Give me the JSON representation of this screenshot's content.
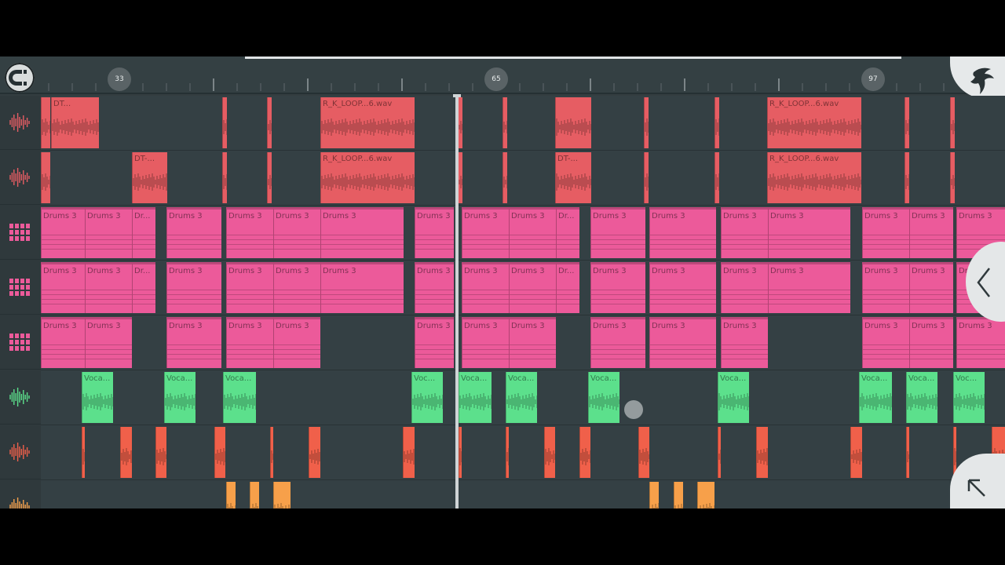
{
  "ruler": {
    "markers": [
      {
        "label": "33"
      },
      {
        "label": "65"
      },
      {
        "label": "97"
      }
    ]
  },
  "tracks": [
    {
      "kind": "audio",
      "color": "#e65d63",
      "icon": "audio-waveform-icon",
      "clips": [
        {
          "s": 0,
          "l": 12,
          "t": ""
        },
        {
          "s": 13,
          "l": 61,
          "t": "DT..."
        },
        {
          "s": 231,
          "l": 6,
          "t": ""
        },
        {
          "s": 288,
          "l": 6,
          "t": ""
        },
        {
          "s": 356,
          "l": 120,
          "t": "R_K_LOOP...6.wav"
        },
        {
          "s": 531,
          "l": 6,
          "t": ""
        },
        {
          "s": 588,
          "l": 6,
          "t": ""
        },
        {
          "s": 655,
          "l": 46,
          "t": ""
        },
        {
          "s": 768,
          "l": 6,
          "t": ""
        },
        {
          "s": 858,
          "l": 6,
          "t": ""
        },
        {
          "s": 925,
          "l": 120,
          "t": "R_K_LOOP...6.wav"
        },
        {
          "s": 1100,
          "l": 6,
          "t": ""
        },
        {
          "s": 1158,
          "l": 6,
          "t": ""
        }
      ]
    },
    {
      "kind": "audio",
      "color": "#e65d63",
      "icon": "audio-waveform-icon",
      "clips": [
        {
          "s": 0,
          "l": 12,
          "t": ""
        },
        {
          "s": 116,
          "l": 45,
          "t": "DT-..."
        },
        {
          "s": 231,
          "l": 6,
          "t": ""
        },
        {
          "s": 288,
          "l": 6,
          "t": ""
        },
        {
          "s": 356,
          "l": 120,
          "t": "R_K_LOOP...6.wav"
        },
        {
          "s": 531,
          "l": 6,
          "t": ""
        },
        {
          "s": 588,
          "l": 6,
          "t": ""
        },
        {
          "s": 655,
          "l": 46,
          "t": "DT-..."
        },
        {
          "s": 768,
          "l": 6,
          "t": ""
        },
        {
          "s": 858,
          "l": 6,
          "t": ""
        },
        {
          "s": 925,
          "l": 120,
          "t": "R_K_LOOP...6.wav"
        },
        {
          "s": 1100,
          "l": 6,
          "t": ""
        },
        {
          "s": 1158,
          "l": 6,
          "t": ""
        }
      ]
    },
    {
      "kind": "pattern",
      "color": "#ec5a9a",
      "icon": "pattern-icon",
      "clips": [
        {
          "s": 0,
          "l": 56,
          "t": "Drums 3"
        },
        {
          "s": 56,
          "l": 60,
          "t": "Drums 3"
        },
        {
          "s": 116,
          "l": 30,
          "t": "Dr..."
        },
        {
          "s": 160,
          "l": 70,
          "t": "Drums 3"
        },
        {
          "s": 236,
          "l": 60,
          "t": "Drums 3"
        },
        {
          "s": 296,
          "l": 60,
          "t": "Drums 3"
        },
        {
          "s": 356,
          "l": 106,
          "t": "Drums 3"
        },
        {
          "s": 476,
          "l": 50,
          "t": "Drums 3"
        },
        {
          "s": 536,
          "l": 60,
          "t": "Drums 3"
        },
        {
          "s": 596,
          "l": 60,
          "t": "Drums 3"
        },
        {
          "s": 656,
          "l": 30,
          "t": "Dr..."
        },
        {
          "s": 700,
          "l": 70,
          "t": "Drums 3"
        },
        {
          "s": 775,
          "l": 85,
          "t": "Drums 3"
        },
        {
          "s": 866,
          "l": 60,
          "t": "Drums 3"
        },
        {
          "s": 926,
          "l": 105,
          "t": "Drums 3"
        },
        {
          "s": 1046,
          "l": 60,
          "t": "Drums 3"
        },
        {
          "s": 1106,
          "l": 56,
          "t": "Drums 3"
        },
        {
          "s": 1166,
          "l": 62,
          "t": "Drums 3"
        }
      ]
    },
    {
      "kind": "pattern",
      "color": "#ec5a9a",
      "icon": "pattern-icon",
      "clips": [
        {
          "s": 0,
          "l": 56,
          "t": "Drums 3"
        },
        {
          "s": 56,
          "l": 60,
          "t": "Drums 3"
        },
        {
          "s": 116,
          "l": 30,
          "t": "Dr..."
        },
        {
          "s": 160,
          "l": 70,
          "t": "Drums 3"
        },
        {
          "s": 236,
          "l": 60,
          "t": "Drums 3"
        },
        {
          "s": 296,
          "l": 60,
          "t": "Drums 3"
        },
        {
          "s": 356,
          "l": 106,
          "t": "Drums 3"
        },
        {
          "s": 476,
          "l": 50,
          "t": "Drums 3"
        },
        {
          "s": 536,
          "l": 60,
          "t": "Drums 3"
        },
        {
          "s": 596,
          "l": 60,
          "t": "Drums 3"
        },
        {
          "s": 656,
          "l": 30,
          "t": "Dr..."
        },
        {
          "s": 700,
          "l": 70,
          "t": "Drums 3"
        },
        {
          "s": 775,
          "l": 85,
          "t": "Drums 3"
        },
        {
          "s": 866,
          "l": 60,
          "t": "Drums 3"
        },
        {
          "s": 926,
          "l": 105,
          "t": "Drums 3"
        },
        {
          "s": 1046,
          "l": 60,
          "t": "Drums 3"
        },
        {
          "s": 1106,
          "l": 56,
          "t": "Drums 3"
        },
        {
          "s": 1166,
          "l": 62,
          "t": "Drums 3"
        }
      ]
    },
    {
      "kind": "pattern",
      "color": "#ec5a9a",
      "icon": "pattern-icon",
      "clips": [
        {
          "s": 0,
          "l": 56,
          "t": "Drums 3"
        },
        {
          "s": 56,
          "l": 60,
          "t": "Drums 3"
        },
        {
          "s": 160,
          "l": 70,
          "t": "Drums 3"
        },
        {
          "s": 236,
          "l": 60,
          "t": "Drums 3"
        },
        {
          "s": 296,
          "l": 60,
          "t": "Drums 3"
        },
        {
          "s": 476,
          "l": 50,
          "t": "Drums 3"
        },
        {
          "s": 536,
          "l": 60,
          "t": "Drums 3"
        },
        {
          "s": 596,
          "l": 60,
          "t": "Drums 3"
        },
        {
          "s": 700,
          "l": 70,
          "t": "Drums 3"
        },
        {
          "s": 775,
          "l": 85,
          "t": "Drums 3"
        },
        {
          "s": 866,
          "l": 60,
          "t": "Drums 3"
        },
        {
          "s": 1046,
          "l": 60,
          "t": "Drums 3"
        },
        {
          "s": 1106,
          "l": 56,
          "t": "Drums 3"
        },
        {
          "s": 1166,
          "l": 62,
          "t": "Drums 3"
        }
      ]
    },
    {
      "kind": "audio",
      "color": "#5ce08c",
      "icon": "audio-waveform-icon",
      "clips": [
        {
          "s": 52,
          "l": 40,
          "t": "Voca..."
        },
        {
          "s": 157,
          "l": 40,
          "t": "Voca..."
        },
        {
          "s": 232,
          "l": 42,
          "t": "Voca..."
        },
        {
          "s": 472,
          "l": 40,
          "t": "Voc..."
        },
        {
          "s": 532,
          "l": 42,
          "t": "Voca..."
        },
        {
          "s": 592,
          "l": 40,
          "t": "Voca..."
        },
        {
          "s": 697,
          "l": 40,
          "t": "Voca..."
        },
        {
          "s": 862,
          "l": 40,
          "t": "Voca..."
        },
        {
          "s": 1042,
          "l": 42,
          "t": "Voca..."
        },
        {
          "s": 1102,
          "l": 40,
          "t": "Voca..."
        },
        {
          "s": 1162,
          "l": 40,
          "t": "Voc..."
        }
      ]
    },
    {
      "kind": "audio",
      "color": "#f0604a",
      "icon": "audio-waveform-icon",
      "clips": [
        {
          "s": 52,
          "l": 4,
          "t": ""
        },
        {
          "s": 101,
          "l": 15,
          "t": ""
        },
        {
          "s": 146,
          "l": 14,
          "t": ""
        },
        {
          "s": 221,
          "l": 14,
          "t": ""
        },
        {
          "s": 292,
          "l": 4,
          "t": ""
        },
        {
          "s": 341,
          "l": 15,
          "t": ""
        },
        {
          "s": 461,
          "l": 15,
          "t": ""
        },
        {
          "s": 532,
          "l": 4,
          "t": ""
        },
        {
          "s": 592,
          "l": 4,
          "t": ""
        },
        {
          "s": 641,
          "l": 14,
          "t": ""
        },
        {
          "s": 686,
          "l": 14,
          "t": ""
        },
        {
          "s": 761,
          "l": 14,
          "t": ""
        },
        {
          "s": 862,
          "l": 4,
          "t": ""
        },
        {
          "s": 911,
          "l": 15,
          "t": ""
        },
        {
          "s": 1031,
          "l": 15,
          "t": ""
        },
        {
          "s": 1102,
          "l": 4,
          "t": ""
        },
        {
          "s": 1162,
          "l": 4,
          "t": ""
        },
        {
          "s": 1211,
          "l": 17,
          "t": ""
        }
      ]
    },
    {
      "kind": "audio",
      "color": "#f7a04a",
      "icon": "audio-waveform-icon",
      "clips": [
        {
          "s": 236,
          "l": 12,
          "t": ""
        },
        {
          "s": 266,
          "l": 12,
          "t": ""
        },
        {
          "s": 296,
          "l": 22,
          "t": ""
        },
        {
          "s": 775,
          "l": 12,
          "t": ""
        },
        {
          "s": 806,
          "l": 12,
          "t": ""
        },
        {
          "s": 836,
          "l": 22,
          "t": ""
        }
      ]
    }
  ],
  "icons": {
    "snap": "magnet-snap-icon",
    "logo": "fruit-logo-icon",
    "collapse": "chevron-left-icon",
    "expand": "expand-arrow-icon"
  }
}
